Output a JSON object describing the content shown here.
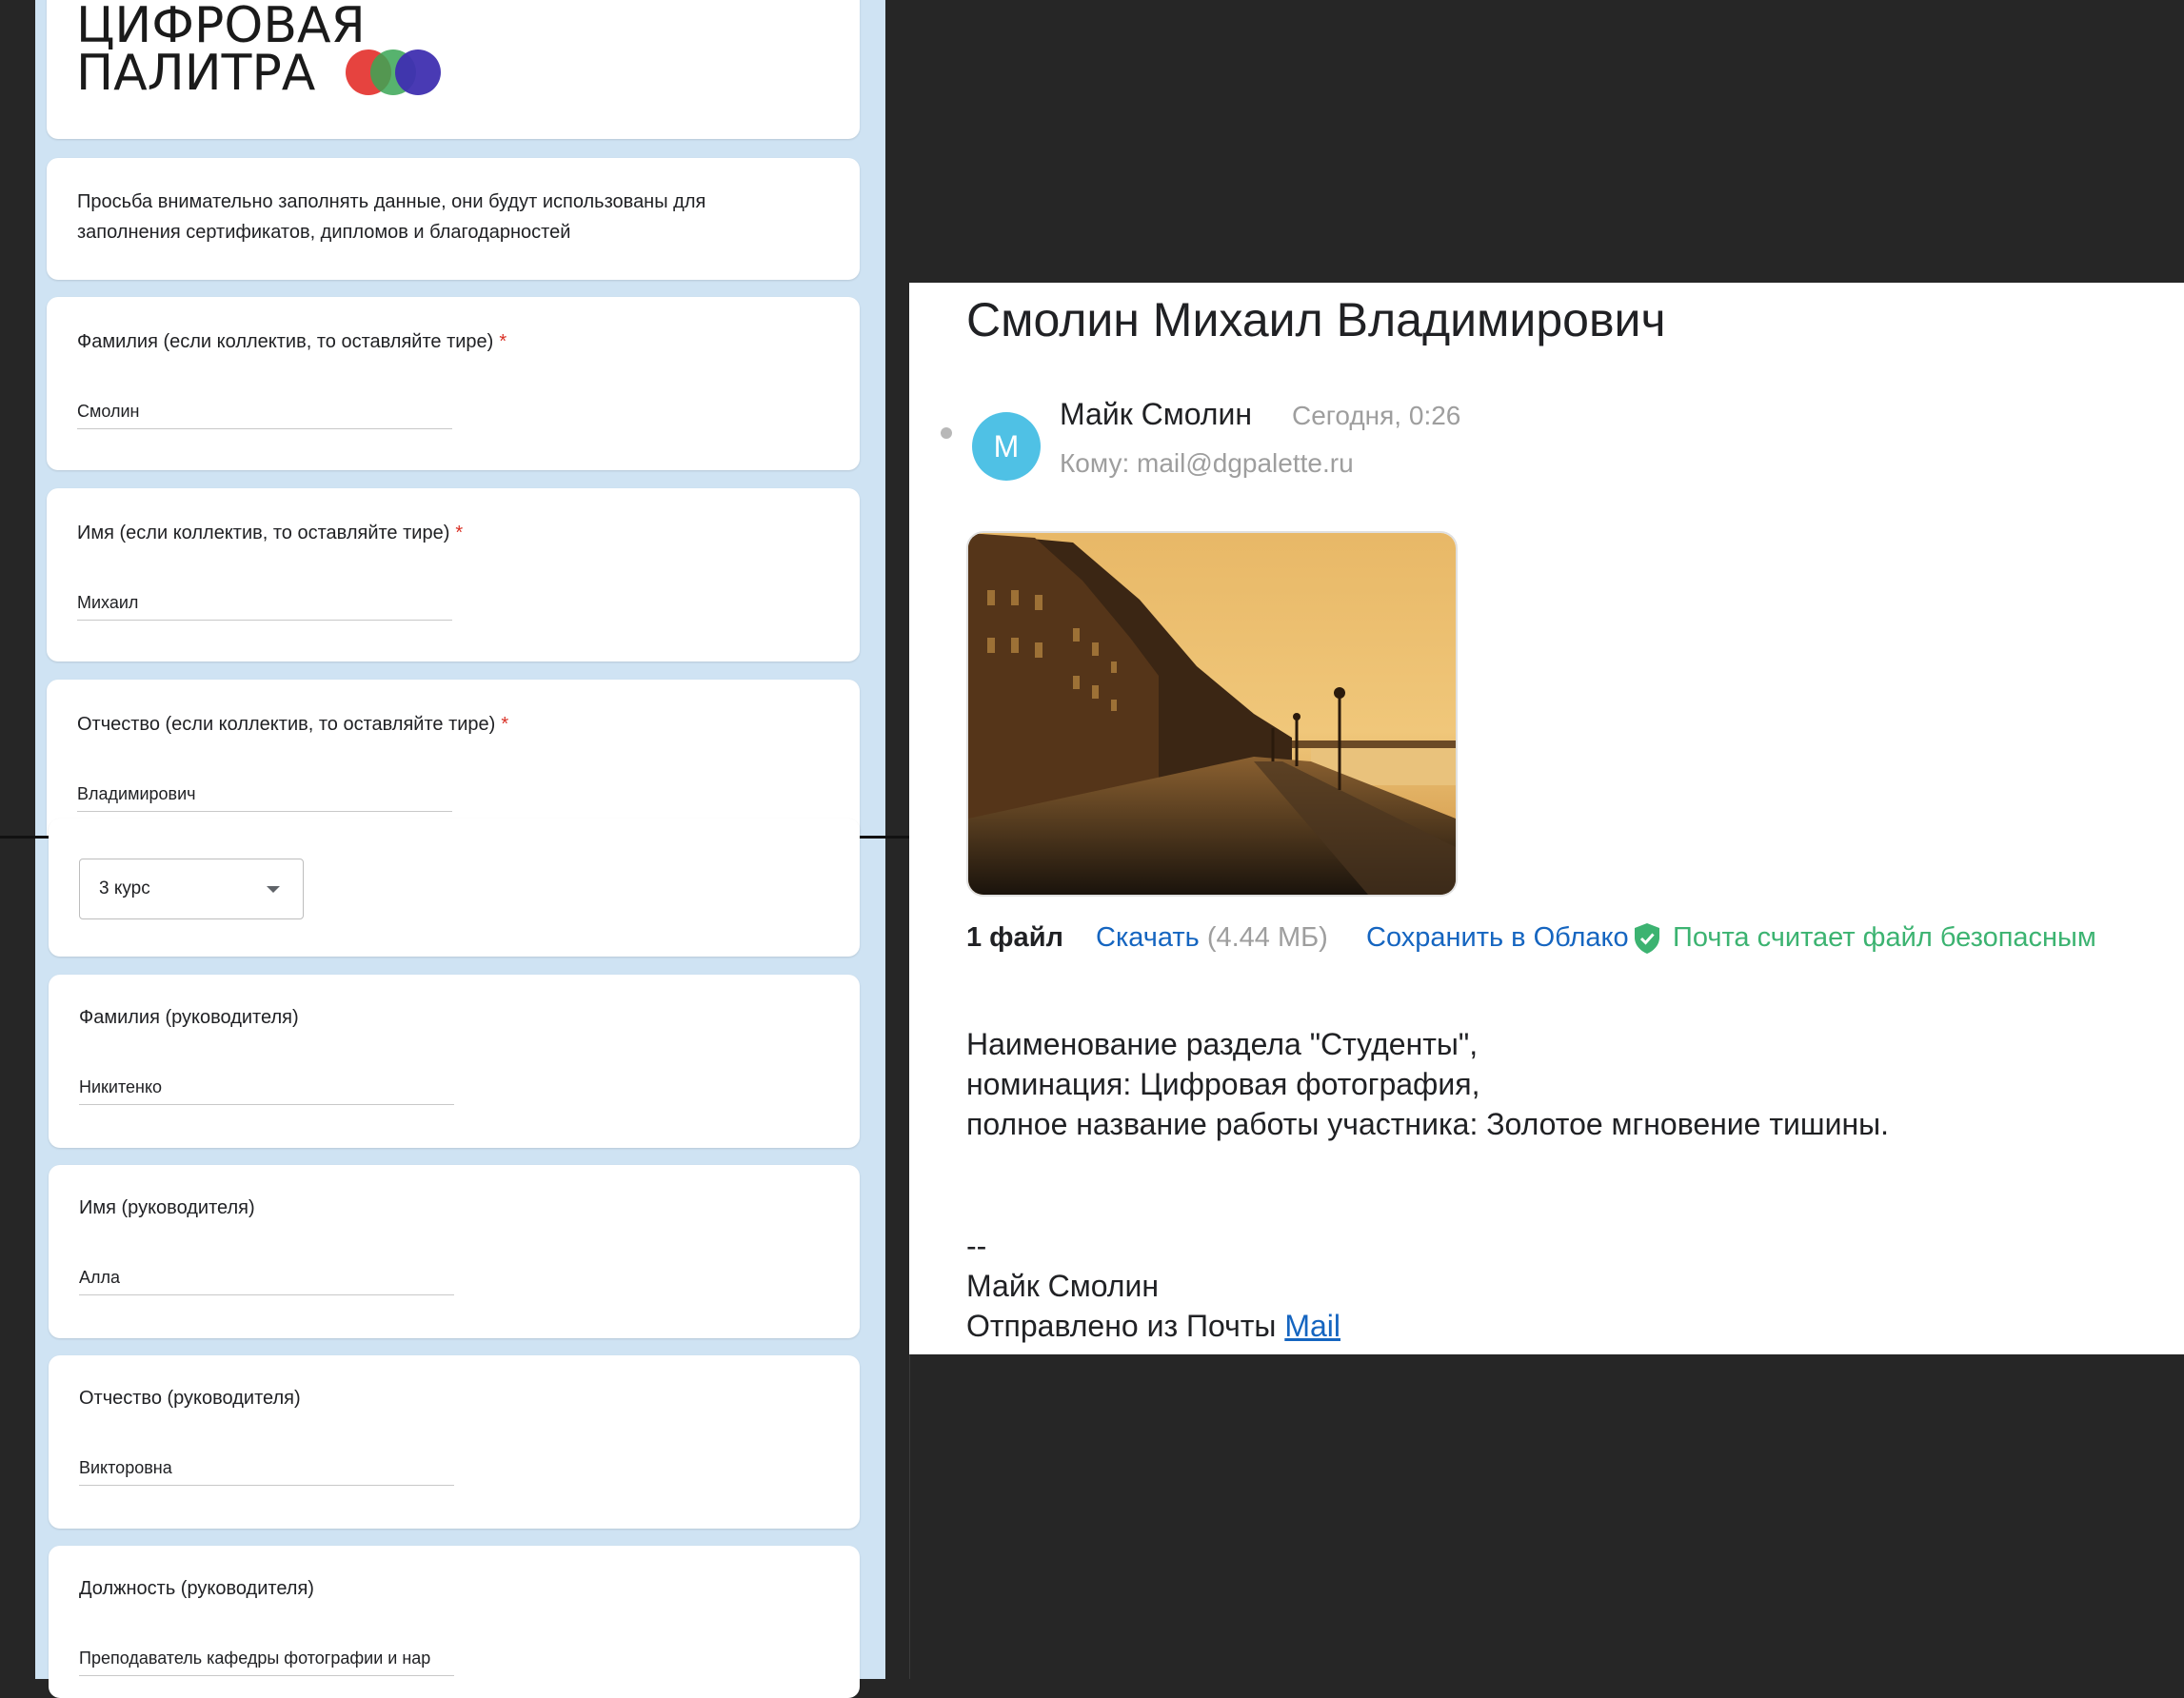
{
  "form": {
    "logo": {
      "line1": "ЦИФРОВАЯ",
      "line2": "ПАЛИТРА"
    },
    "description": "Просьба внимательно заполнять данные, они будут использованы для заполнения сертификатов, дипломов и благодарностей",
    "required_mark": "*",
    "fields_top": [
      {
        "label": "Фамилия (если коллектив, то оставляйте тире)",
        "value": "Смолин",
        "required": true
      },
      {
        "label": "Имя (если коллектив, то оставляйте тире)",
        "value": "Михаил",
        "required": true
      },
      {
        "label": "Отчество (если коллектив, то оставляйте тире)",
        "value": "Владимирович",
        "required": true
      }
    ],
    "course_select": {
      "value": "3 курс"
    },
    "fields_bottom": [
      {
        "label": "Фамилия (руководителя)",
        "value": "Никитенко"
      },
      {
        "label": "Имя (руководителя)",
        "value": "Алла"
      },
      {
        "label": "Отчество (руководителя)",
        "value": "Викторовна"
      },
      {
        "label": "Должность (руководителя)",
        "value": "Преподаватель кафедры фотографии и нар"
      }
    ]
  },
  "email": {
    "subject": "Смолин Михаил Владимирович",
    "avatar_letter": "M",
    "sender": "Майк Смолин",
    "date": "Сегодня, 0:26",
    "to": "Кому: mail@dgpalette.ru",
    "files_count": "1 файл",
    "download": "Скачать",
    "size": "(4.44 МБ)",
    "save_cloud": "Сохранить в Облако",
    "safe": "Почта считает файл безопасным",
    "body": [
      "Наименование раздела \"Студенты\",",
      "номинация: Цифровая фотография,",
      "полное название работы участника: Золотое мгновение тишины."
    ],
    "sig_sep": "--",
    "sig_name": "Майк Смолин",
    "sig_sent": "Отправлено из Почты",
    "sig_link": "Mail"
  },
  "colors": {
    "accent_blue": "#1565c0",
    "safe_green": "#3cb371",
    "avatar": "#4fc1e5",
    "form_bg": "#cfe3f3"
  }
}
